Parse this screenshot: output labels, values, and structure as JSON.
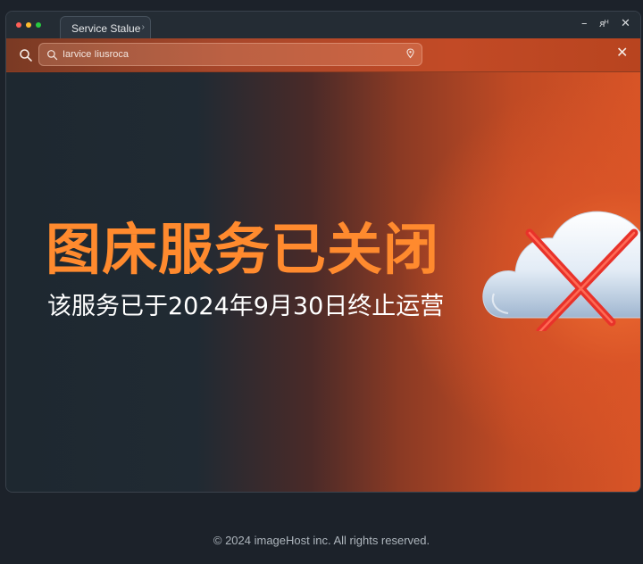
{
  "window": {
    "tab_title": "Service Stalue",
    "tab_chevron": "›",
    "controls": {
      "minimize": "–",
      "restore": "ᴙᴴ",
      "close": "✕"
    }
  },
  "toolbar": {
    "search_icon": "search-icon",
    "url_text": "Iarvice Iiusroca",
    "url_trailing_icon": "pin-icon",
    "close_label": "✕"
  },
  "main": {
    "headline": "图床服务已关闭",
    "subline": "该服务已于2024年9月30日终止运营",
    "illustration": "cloud-with-red-x-icon"
  },
  "footer": {
    "text": "© 2024 imageHost inc. All rights reserved."
  },
  "colors": {
    "accent_orange": "#ff8a2e",
    "banner_red": "#d85426",
    "background_dark": "#1c222a",
    "cross_red": "#e8322a"
  }
}
